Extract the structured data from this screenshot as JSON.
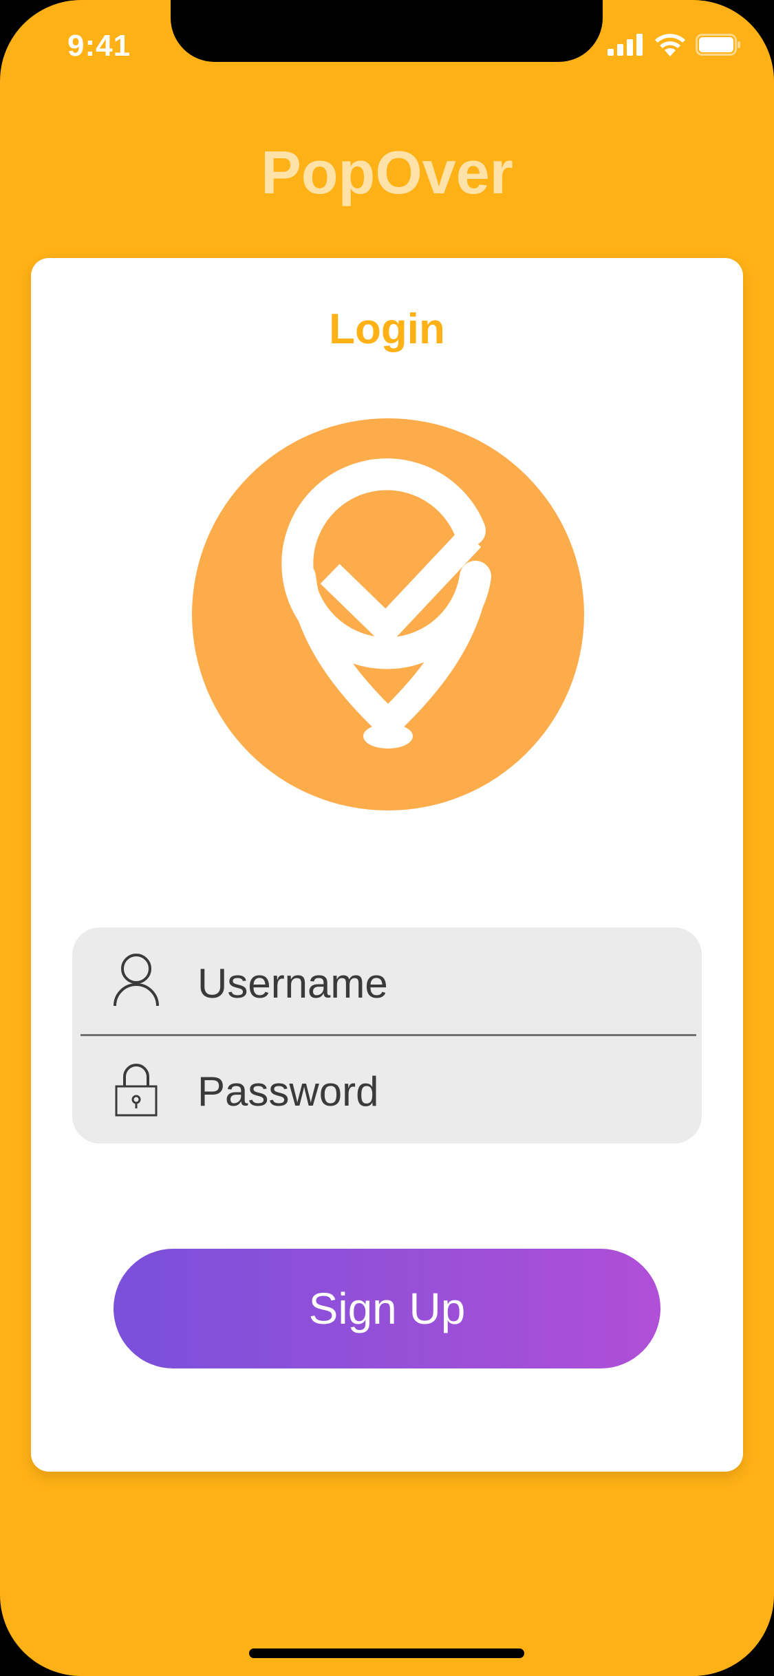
{
  "status_bar": {
    "time": "9:41",
    "icons": [
      "cellular-signal-icon",
      "wifi-icon",
      "battery-icon"
    ]
  },
  "app": {
    "title": "PopOver"
  },
  "login_card": {
    "heading": "Login",
    "logo_icon": "location-pin-check-icon"
  },
  "form": {
    "username": {
      "placeholder": "Username",
      "value": "",
      "icon": "user-icon"
    },
    "password": {
      "placeholder": "Password",
      "value": "",
      "icon": "lock-icon"
    },
    "signup_label": "Sign Up"
  },
  "colors": {
    "background": "#FFB116",
    "title_text": "#FFE2A8",
    "logo_circle": "#FDAC4C",
    "input_background": "#EBEBEB",
    "button_gradient_start": "#7A50DA",
    "button_gradient_end": "#B04FD7"
  }
}
